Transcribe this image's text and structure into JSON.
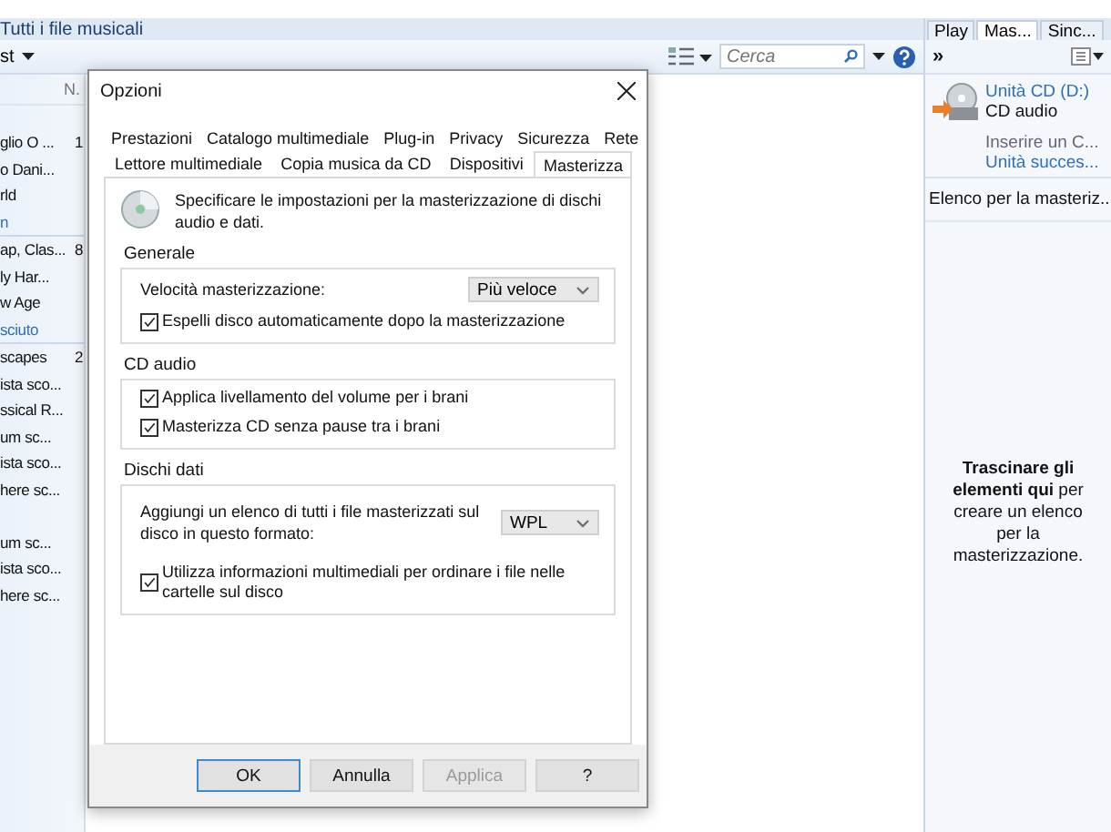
{
  "breadcrumb": "Tutti i file musicali",
  "toolbar": {
    "menu_label": "st",
    "search": {
      "placeholder": "Cerca"
    }
  },
  "library": {
    "column_header": "N.",
    "rows": [
      {
        "kind": "item",
        "text": "glio O ...",
        "count": "1"
      },
      {
        "kind": "item",
        "text": "o Dani..."
      },
      {
        "kind": "item",
        "text": "rld"
      },
      {
        "kind": "heading",
        "text": "n"
      },
      {
        "kind": "item",
        "text": "ap, Clas...",
        "count": "8"
      },
      {
        "kind": "item",
        "text": "ly Har..."
      },
      {
        "kind": "item",
        "text": "w Age"
      },
      {
        "kind": "heading",
        "text": "sciuto"
      },
      {
        "kind": "item",
        "text": "scapes",
        "count": "2"
      },
      {
        "kind": "item",
        "text": "ista sco..."
      },
      {
        "kind": "item",
        "text": "ssical R..."
      },
      {
        "kind": "item",
        "text": "um sc..."
      },
      {
        "kind": "item",
        "text": "ista sco..."
      },
      {
        "kind": "item",
        "text": "here sc..."
      },
      {
        "kind": "gap",
        "text": ""
      },
      {
        "kind": "item",
        "text": "um sc..."
      },
      {
        "kind": "item",
        "text": "ista sco..."
      },
      {
        "kind": "item",
        "text": "here sc..."
      }
    ]
  },
  "right_panel": {
    "tabs": [
      {
        "label": "Play",
        "selected": false
      },
      {
        "label": "Mas...",
        "selected": true
      },
      {
        "label": "Sinc...",
        "selected": false
      }
    ],
    "overflow": "»",
    "device": {
      "name": "Unità CD (D:)",
      "type": "CD audio",
      "status": "Inserire un C...",
      "status_2": "Unità succes..."
    },
    "list_title": "Elenco per la masteriz...",
    "hint": "**Trascinare gli elementi qui** per creare un elenco per la masterizzazione."
  },
  "dialog": {
    "title": "Opzioni",
    "tab_rows": [
      [
        {
          "label": "Prestazioni",
          "selected": false
        },
        {
          "label": "Catalogo multimediale",
          "selected": false
        },
        {
          "label": "Plug-in",
          "selected": false
        },
        {
          "label": "Privacy",
          "selected": false
        },
        {
          "label": "Sicurezza",
          "selected": false
        },
        {
          "label": "Rete",
          "selected": false
        }
      ],
      [
        {
          "label": "Lettore multimediale",
          "selected": false
        },
        {
          "label": "Copia musica da CD",
          "selected": false
        },
        {
          "label": "Dispositivi",
          "selected": false
        },
        {
          "label": "Masterizza",
          "selected": true
        }
      ]
    ],
    "description": "Specificare le impostazioni per la masterizzazione di dischi audio e dati.",
    "groups": [
      {
        "title": "Generale",
        "items": [
          {
            "kind": "dropdown",
            "label": "Velocità masterizzazione:",
            "value": "Più veloce"
          },
          {
            "kind": "checkbox",
            "label": "Espelli disco automaticamente dopo la masterizzazione",
            "checked": true
          }
        ]
      },
      {
        "title": "CD audio",
        "items": [
          {
            "kind": "checkbox",
            "label": "Applica livellamento del volume per i brani",
            "checked": true
          },
          {
            "kind": "checkbox",
            "label": "Masterizza CD senza pause tra i brani",
            "checked": true
          }
        ]
      },
      {
        "title": "Dischi dati",
        "items": [
          {
            "kind": "dropdown",
            "label": "Aggiungi un elenco di tutti i file masterizzati sul disco in questo formato:",
            "value": "WPL"
          },
          {
            "kind": "checkbox",
            "label": "Utilizza informazioni multimediali per ordinare i file nelle cartelle sul disco",
            "checked": true
          }
        ]
      }
    ],
    "buttons": [
      {
        "label": "OK",
        "default": true,
        "disabled": false
      },
      {
        "label": "Annulla",
        "default": false,
        "disabled": false
      },
      {
        "label": "Applica",
        "default": false,
        "disabled": true
      },
      {
        "label": "?",
        "default": false,
        "disabled": false
      }
    ]
  }
}
